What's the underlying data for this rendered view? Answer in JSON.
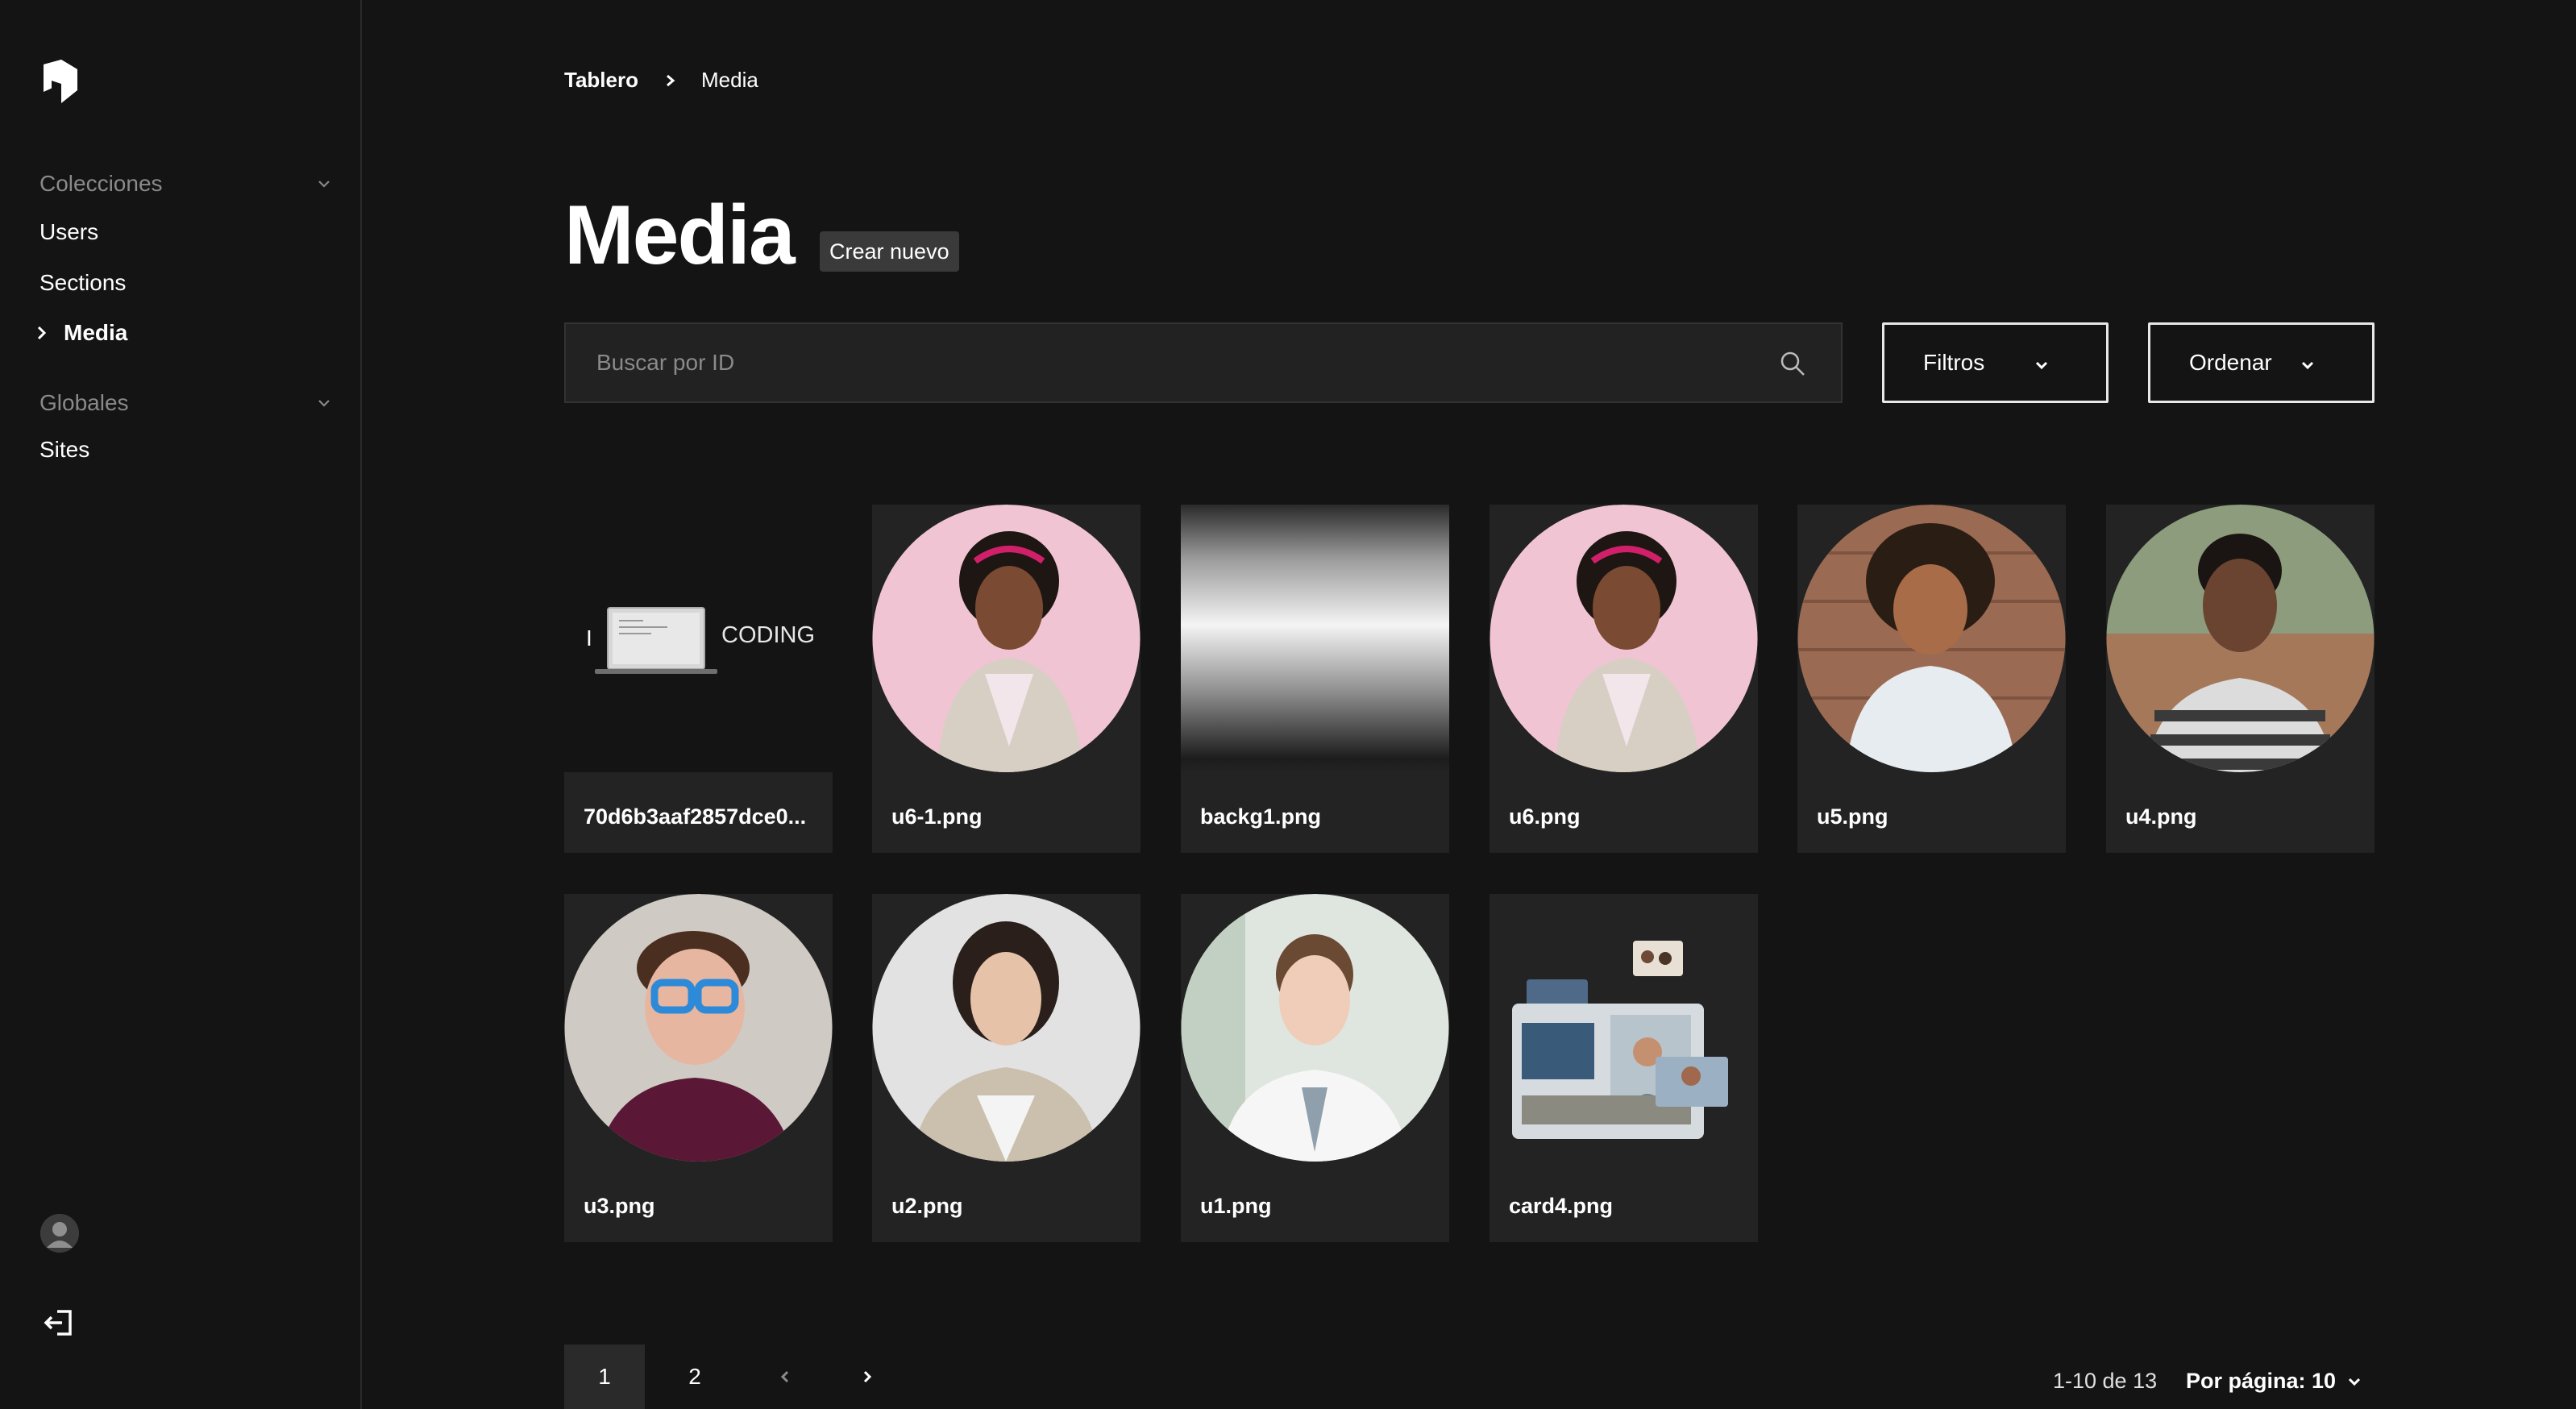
{
  "sidebar": {
    "collections_label": "Colecciones",
    "collections": [
      "Users",
      "Sections",
      "Media"
    ],
    "active_item": "Media",
    "globals_label": "Globales",
    "globals": [
      "Sites"
    ]
  },
  "breadcrumb": {
    "home": "Tablero",
    "current": "Media"
  },
  "header": {
    "title": "Media",
    "create_label": "Crear nuevo"
  },
  "search": {
    "placeholder": "Buscar por ID",
    "value": ""
  },
  "controls": {
    "filters_label": "Filtros",
    "sort_label": "Ordenar"
  },
  "media": {
    "items": [
      {
        "filename": "70d6b3aaf2857dce0...",
        "thumb_text": "CODING",
        "thumb_prefix": "I"
      },
      {
        "filename": "u6-1.png"
      },
      {
        "filename": "backg1.png"
      },
      {
        "filename": "u6.png"
      },
      {
        "filename": "u5.png"
      },
      {
        "filename": "u4.png"
      },
      {
        "filename": "u3.png"
      },
      {
        "filename": "u2.png"
      },
      {
        "filename": "u1.png"
      },
      {
        "filename": "card4.png"
      }
    ]
  },
  "pagination": {
    "pages": [
      "1",
      "2"
    ],
    "current_page": "1",
    "range_text": "1-10 de 13",
    "per_page_text": "Por página: 10"
  },
  "colors": {
    "background": "#141414",
    "card": "#232323",
    "text": "#ffffff",
    "muted": "#8a8a8a"
  }
}
